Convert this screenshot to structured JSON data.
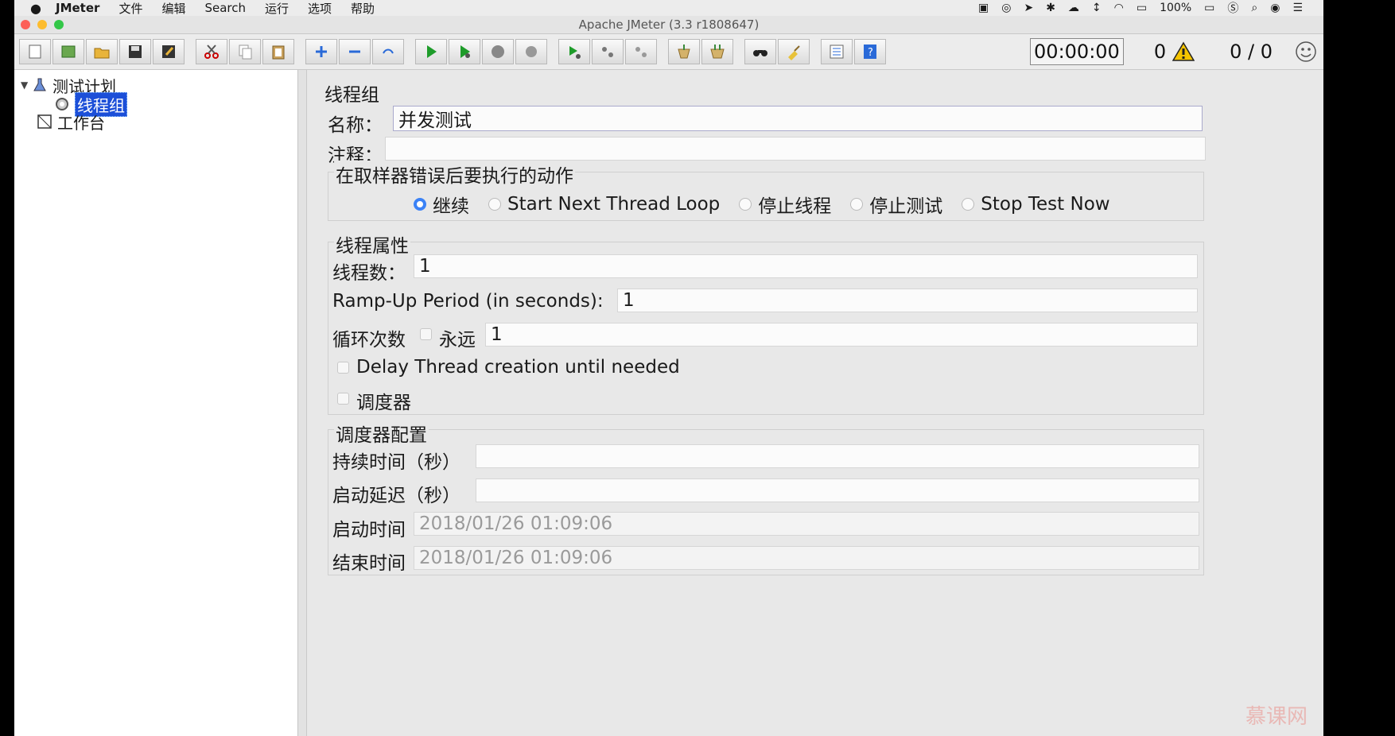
{
  "menubar": {
    "app": "JMeter",
    "items": [
      "文件",
      "编辑",
      "Search",
      "运行",
      "选项",
      "帮助"
    ],
    "battery": "100%"
  },
  "window": {
    "title": "Apache JMeter (3.3 r1808647)"
  },
  "status": {
    "elapsed": "00:00:00",
    "warnings": "0",
    "threads": "0 / 0"
  },
  "tree": {
    "plan": "测试计划",
    "thread_group": "线程组",
    "workbench": "工作台"
  },
  "panel": {
    "heading": "线程组",
    "name_label": "名称：",
    "name_value": "并发测试",
    "comment_label": "注释：",
    "comment_value": "",
    "error_action": {
      "title": "在取样器错误后要执行的动作",
      "options": [
        "继续",
        "Start Next Thread Loop",
        "停止线程",
        "停止测试",
        "Stop Test Now"
      ],
      "selected": "继续"
    },
    "thread_props": {
      "title": "线程属性",
      "threads_label": "线程数：",
      "threads_value": "1",
      "rampup_label": "Ramp-Up Period (in seconds):",
      "rampup_value": "1",
      "loop_label": "循环次数",
      "forever_label": "永远",
      "loop_value": "1",
      "delay_label": "Delay Thread creation until needed",
      "scheduler_label": "调度器"
    },
    "scheduler": {
      "title": "调度器配置",
      "duration_label": "持续时间（秒）",
      "duration_value": "",
      "delay_label": "启动延迟（秒）",
      "delay_value": "",
      "start_label": "启动时间",
      "start_value": "2018/01/26 01:09:06",
      "end_label": "结束时间",
      "end_value": "2018/01/26 01:09:06"
    }
  },
  "watermark": "慕课网",
  "colors": {
    "selection": "#1c4fd8",
    "radio_on": "#3b82f6",
    "close": "#fc5f57",
    "minimize": "#fdbc2e",
    "zoom": "#33c748"
  }
}
